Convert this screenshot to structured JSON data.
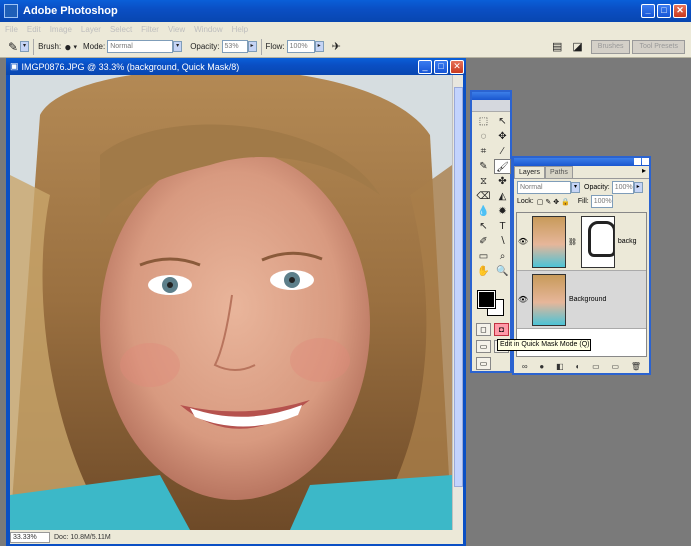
{
  "app": {
    "title": "Adobe Photoshop",
    "window_buttons": [
      "_",
      "□",
      "✕"
    ]
  },
  "menubar": {
    "items": [
      "File",
      "Edit",
      "Image",
      "Layer",
      "Select",
      "Filter",
      "View",
      "Window",
      "Help"
    ]
  },
  "options_bar": {
    "brush_label": "Brush:",
    "mode_label": "Mode:",
    "mode_value": "Normal",
    "opacity_label": "Opacity:",
    "opacity_value": "53%",
    "flow_label": "Flow:",
    "flow_value": "100%",
    "well_tabs": [
      "Brushes",
      "Tool Presets"
    ]
  },
  "document": {
    "title": "IMGP0876.JPG @ 33.3% (background, Quick Mask/8)",
    "zoom": "33.33%",
    "status": "Doc: 10.8M/5.11M"
  },
  "tools": {
    "items": [
      "⬚",
      "↖",
      "◌",
      "✥",
      "⌗",
      "∕",
      "✎",
      "🖌",
      "⧖",
      "✤",
      "⌫",
      "◭",
      "💧",
      "✹",
      "↖",
      "T",
      "✐",
      "∖",
      "▭",
      "⌕",
      "✋",
      "🔍"
    ],
    "quickmask_labels": [
      "◻",
      "◘"
    ],
    "screen_modes": [
      "▭",
      "▭",
      "▭"
    ],
    "tooltip": "Edit in Quick Mask Mode (Q)"
  },
  "layers_panel": {
    "tabs": [
      "Layers",
      "Paths"
    ],
    "blend_mode": "Normal",
    "opacity_label": "Opacity:",
    "opacity_value": "100%",
    "lock_label": "Lock:",
    "fill_label": "Fill:",
    "fill_value": "100%",
    "layers": [
      {
        "name": "backg",
        "has_mask": true
      },
      {
        "name": "Background",
        "has_mask": false
      }
    ],
    "footer_icons": [
      "∞",
      "●",
      "◧",
      "◐",
      "▭",
      "▭",
      "🗑"
    ]
  },
  "colors": {
    "xp_blue": "#0a4fc4",
    "chrome": "#ece9d8",
    "workspace": "#7a7a7a"
  }
}
